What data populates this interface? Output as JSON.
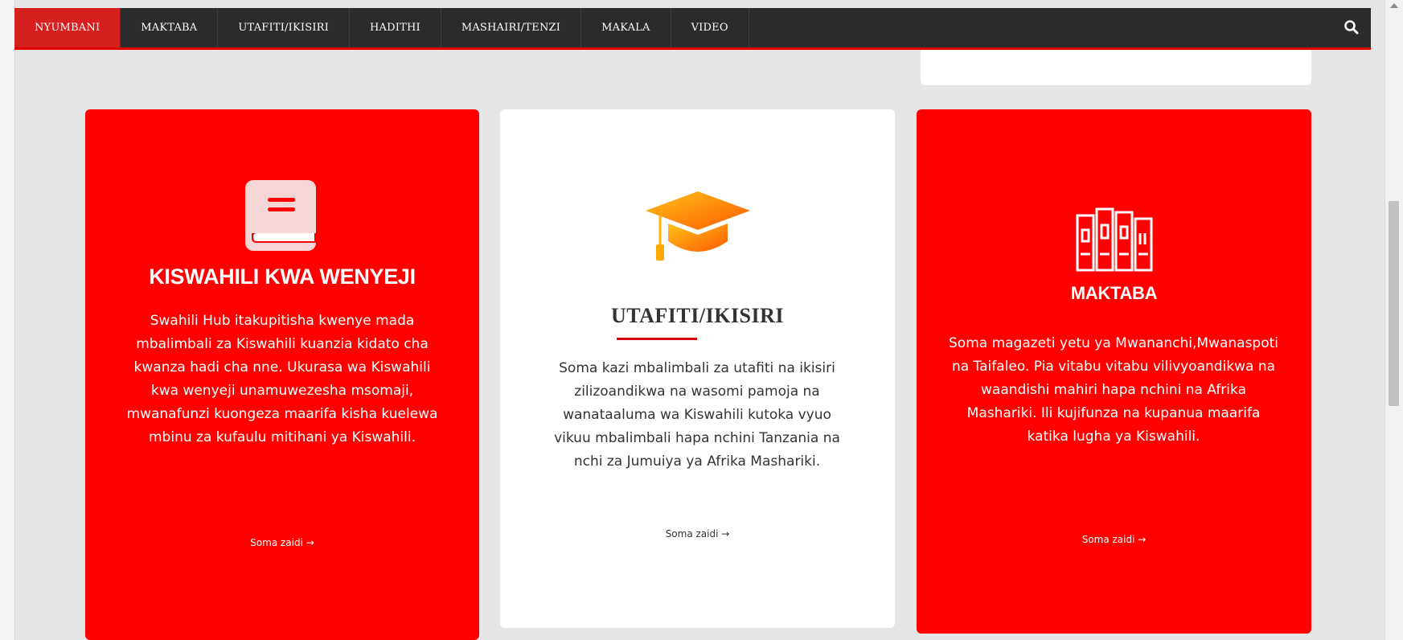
{
  "nav": {
    "items": [
      {
        "label": "NYUMBANI",
        "active": true
      },
      {
        "label": "MAKTABA"
      },
      {
        "label": "UTAFITI/IKISIRI"
      },
      {
        "label": "HADITHI"
      },
      {
        "label": "MASHAIRI/TENZI"
      },
      {
        "label": "MAKALA"
      },
      {
        "label": "VIDEO"
      }
    ],
    "search_icon": "search-icon"
  },
  "cards": [
    {
      "icon": "book-icon",
      "title": "KISWAHILI KWA WENYEJI",
      "text": "Swahili Hub itakupitisha kwenye mada mbalimbali za Kiswahili kuanzia kidato cha kwanza hadi cha nne. Ukurasa wa Kiswahili kwa wenyeji unamuwezesha msomaji, mwanafunzi kuongeza maarifa kisha kuelewa mbinu za kufaulu mitihani ya Kiswahili.",
      "read_more": "Soma zaidi →",
      "background": "#ff0000"
    },
    {
      "icon": "graduation-cap-icon",
      "title": "UTAFITI/IKISIRI",
      "text": "Soma kazi mbalimbali za utafiti na ikisiri zilizoandikwa na wasomi pamoja na wanataaluma wa Kiswahili kutoka vyuo vikuu mbalimbali hapa nchini Tanzania na nchi za Jumuiya ya Afrika Mashariki.",
      "read_more": "Soma zaidi →",
      "background": "#ffffff"
    },
    {
      "icon": "bookshelf-icon",
      "title": "MAKTABA",
      "text": "Soma magazeti yetu ya Mwananchi,Mwanaspoti na Taifaleo. Pia vitabu vitabu vilivyoandikwa na waandishi mahiri hapa nchini na Afrika Mashariki. Ili kujifunza na kupanua maarifa katika lugha ya Kiswahili.",
      "read_more": "Soma zaidi →",
      "background": "#ff0000"
    }
  ],
  "colors": {
    "nav_background": "#2b2b2b",
    "nav_active": "#d61f1f",
    "accent_red": "#ff0000",
    "page_background": "#e6e6e6"
  }
}
